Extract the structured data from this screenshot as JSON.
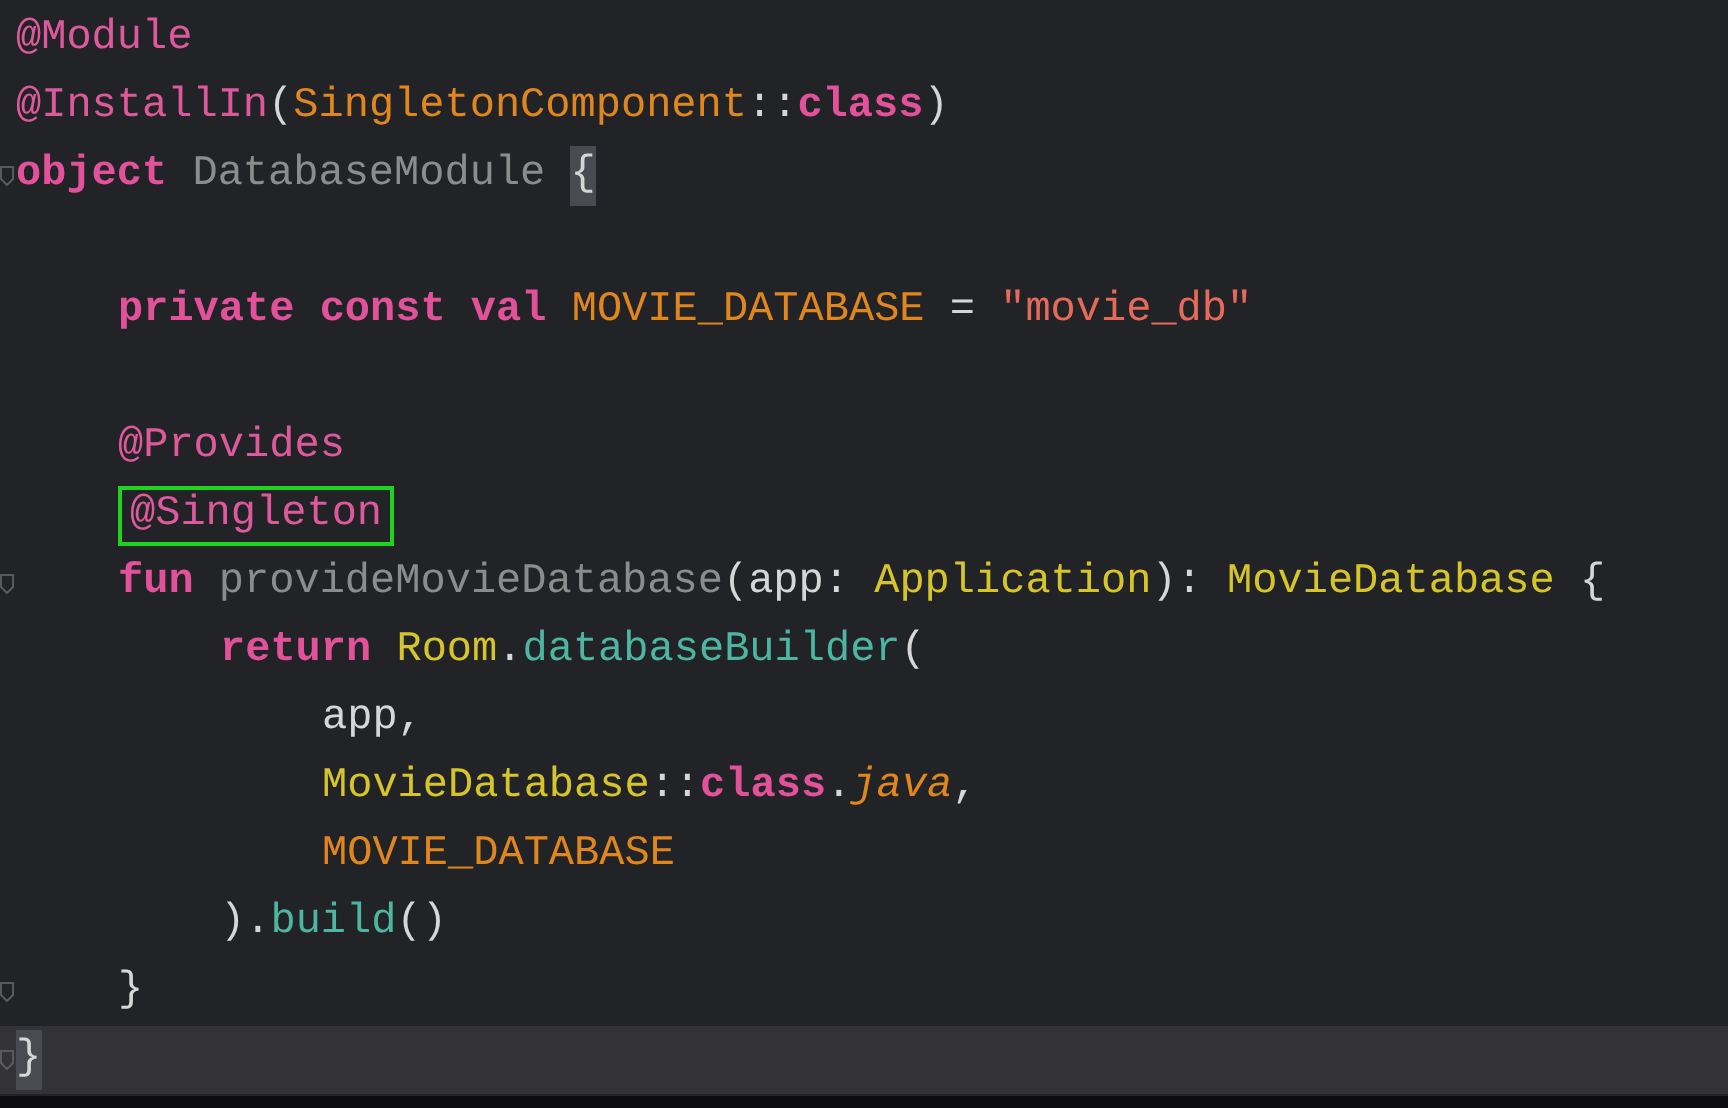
{
  "editor": {
    "lines": [
      {
        "current": false,
        "fold": false,
        "tokens": [
          {
            "text": "@Module",
            "kind": "annotation"
          }
        ]
      },
      {
        "current": false,
        "fold": false,
        "tokens": [
          {
            "text": "@InstallIn",
            "kind": "annotation"
          },
          {
            "text": "(",
            "kind": "plain"
          },
          {
            "text": "SingletonComponent",
            "kind": "constant"
          },
          {
            "text": "::",
            "kind": "plain"
          },
          {
            "text": "class",
            "kind": "keyword"
          },
          {
            "text": ")",
            "kind": "plain"
          }
        ]
      },
      {
        "current": false,
        "fold": true,
        "tokens": [
          {
            "text": "object ",
            "kind": "keyword"
          },
          {
            "text": "DatabaseModule ",
            "kind": "dim"
          },
          {
            "text": "{",
            "kind": "plain",
            "matched": true
          }
        ],
        "children": [
          {
            "current": false,
            "fold": false
          },
          {
            "current": false,
            "fold": false,
            "tokens": [
              {
                "text": "private const val ",
                "kind": "keyword"
              },
              {
                "text": "MOVIE_DATABASE",
                "kind": "constant"
              },
              {
                "text": " = ",
                "kind": "plain"
              },
              {
                "text": "\"movie_db\"",
                "kind": "string"
              }
            ]
          },
          {
            "current": false,
            "fold": false
          },
          {
            "current": false,
            "fold": false,
            "tokens": [
              {
                "text": "@Provides",
                "kind": "annotation"
              }
            ]
          },
          {
            "current": false,
            "fold": false,
            "tokens": [
              {
                "text": "@Singleton",
                "kind": "annotation",
                "boxed": true
              }
            ]
          },
          {
            "current": false,
            "fold": true,
            "tokens": [
              {
                "text": "fun ",
                "kind": "keyword"
              },
              {
                "text": "provideMovieDatabase",
                "kind": "dim"
              },
              {
                "text": "(app: ",
                "kind": "plain"
              },
              {
                "text": "Application",
                "kind": "type"
              },
              {
                "text": "): ",
                "kind": "plain"
              },
              {
                "text": "MovieDatabase",
                "kind": "type"
              },
              {
                "text": " {",
                "kind": "plain"
              }
            ],
            "children": [
              {
                "current": false,
                "fold": false,
                "tokens": [
                  {
                    "text": "return ",
                    "kind": "keyword"
                  },
                  {
                    "text": "Room",
                    "kind": "type"
                  },
                  {
                    "text": ".",
                    "kind": "plain"
                  },
                  {
                    "text": "databaseBuilder",
                    "kind": "function"
                  },
                  {
                    "text": "(",
                    "kind": "plain"
                  }
                ],
                "children": [
                  {
                    "current": false,
                    "fold": false,
                    "tokens": [
                      {
                        "text": "app,",
                        "kind": "plain"
                      }
                    ]
                  },
                  {
                    "current": false,
                    "fold": false,
                    "tokens": [
                      {
                        "text": "MovieDatabase",
                        "kind": "type"
                      },
                      {
                        "text": "::",
                        "kind": "plain"
                      },
                      {
                        "text": "class",
                        "kind": "keyword"
                      },
                      {
                        "text": ".",
                        "kind": "plain"
                      },
                      {
                        "text": "java",
                        "kind": "italic"
                      },
                      {
                        "text": ",",
                        "kind": "plain"
                      }
                    ]
                  },
                  {
                    "current": false,
                    "fold": false,
                    "tokens": [
                      {
                        "text": "MOVIE_DATABASE",
                        "kind": "constant"
                      }
                    ]
                  }
                ]
              },
              {
                "current": false,
                "fold": false,
                "tokens": [
                  {
                    "text": ").",
                    "kind": "plain"
                  },
                  {
                    "text": "build",
                    "kind": "function"
                  },
                  {
                    "text": "()",
                    "kind": "plain"
                  }
                ]
              }
            ]
          },
          {
            "current": false,
            "fold": true,
            "tokens": [
              {
                "text": "}",
                "kind": "plain"
              }
            ]
          }
        ]
      },
      {
        "current": true,
        "fold": true,
        "tokens": [
          {
            "text": "}",
            "kind": "plain",
            "matched": true
          }
        ]
      }
    ]
  }
}
